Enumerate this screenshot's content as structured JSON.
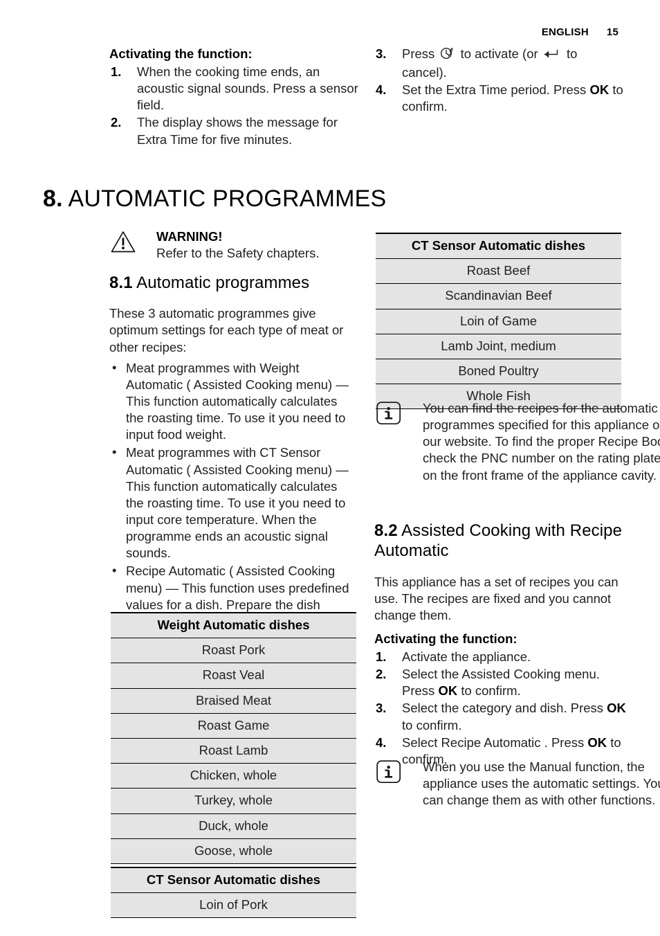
{
  "header": {
    "language": "ENGLISH",
    "page_number": "15"
  },
  "left_column": {
    "activating_heading": "Activating the function:",
    "steps": [
      {
        "num": "1.",
        "text": "When the cooking time ends, an acoustic signal sounds. Press a sensor field."
      },
      {
        "num": "2.",
        "text": "The display shows the message for Extra Time for five minutes."
      }
    ]
  },
  "right_column_top": {
    "steps": [
      {
        "num": "3.",
        "text_before": "Press",
        "icon1": "clock-timer-icon",
        "text_mid": "to activate (or",
        "icon2": "return-arrow-icon",
        "text_after": "to cancel)."
      },
      {
        "num": "4.",
        "text_before": "Set the Extra Time period. Press",
        "bold": "OK",
        "text_after": "to confirm."
      }
    ]
  },
  "chapter": {
    "number": "8.",
    "title": "AUTOMATIC PROGRAMMES"
  },
  "warning": {
    "icon": "warning-triangle-icon",
    "title": "WARNING!",
    "text": "Refer to the Safety chapters."
  },
  "section_8_1": {
    "number": "8.1",
    "title": "Automatic programmes",
    "intro": "These 3 automatic programmes give optimum settings for each type of meat or other recipes:",
    "bullets": [
      "Meat programmes with Weight Automatic ( Assisted Cooking menu) — This function automatically calculates the roasting time. To use it you need to input food weight.",
      "Meat programmes with CT Sensor Automatic ( Assisted Cooking menu) — This function automatically calculates the roasting time. To use it you need to input core temperature. When the programme ends an acoustic signal sounds.",
      "Recipe Automatic ( Assisted Cooking menu) — This function uses predefined values for a dish. Prepare the dish according to recipe from this book."
    ]
  },
  "table_weight_automatic": {
    "header": "Weight Automatic dishes",
    "rows": [
      "Roast Pork",
      "Roast Veal",
      "Braised Meat",
      "Roast Game",
      "Roast Lamb",
      "Chicken, whole",
      "Turkey, whole",
      "Duck, whole",
      "Goose, whole"
    ]
  },
  "table_ct_sensor_left": {
    "header": "CT Sensor Automatic dishes",
    "rows": [
      "Loin of Pork"
    ]
  },
  "table_ct_sensor_right": {
    "header": "CT Sensor Automatic dishes",
    "rows": [
      "Roast Beef",
      "Scandinavian Beef",
      "Loin of Game",
      "Lamb Joint, medium",
      "Boned Poultry",
      "Whole Fish"
    ]
  },
  "note_recipes": {
    "icon": "info-icon",
    "text": "You can find the recipes for the automatic programmes specified for this appliance on our website. To find the proper Recipe Book check the PNC number on the rating plate on the front frame of the appliance cavity."
  },
  "section_8_2": {
    "number": "8.2",
    "title": "Assisted Cooking with Recipe Automatic",
    "intro": "This appliance has a set of recipes you can use. The recipes are fixed and you cannot change them.",
    "activating_heading": "Activating the function:",
    "steps": [
      {
        "num": "1.",
        "text": "Activate the appliance."
      },
      {
        "num": "2.",
        "text_before": "Select the Assisted Cooking menu. Press",
        "bold": "OK",
        "text_after": "to confirm."
      },
      {
        "num": "3.",
        "text_before": "Select the category and dish. Press",
        "bold": "OK",
        "text_after": "to confirm."
      },
      {
        "num": "4.",
        "text_before": "Select Recipe Automatic . Press",
        "bold": "OK",
        "text_after": "to confirm."
      }
    ]
  },
  "note_manual": {
    "icon": "info-icon",
    "text": "When you use the Manual function, the appliance uses the automatic settings. You can change them as with other functions."
  },
  "colors": {
    "page_background": "#ffffff",
    "text": "#222222",
    "table_background": "#e4e4e4",
    "rule": "#000000"
  }
}
